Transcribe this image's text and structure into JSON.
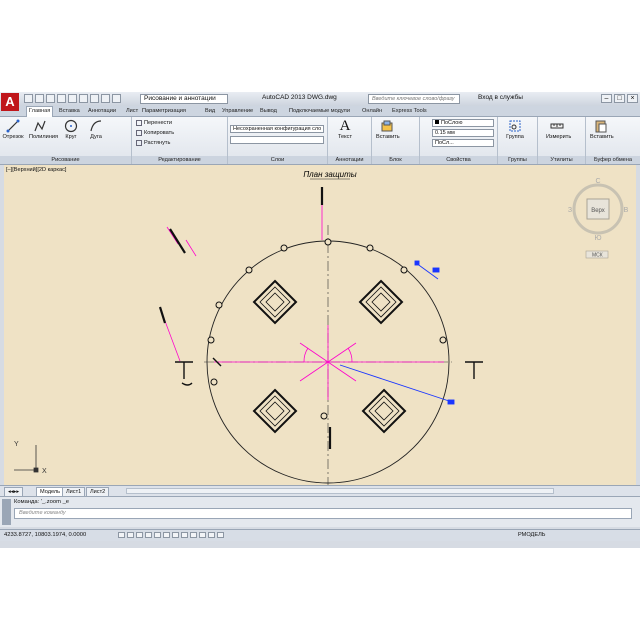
{
  "app": {
    "logo_letter": "A",
    "workspace": "Рисование и аннотации",
    "title": "AutoCAD 2013    DWG.dwg",
    "search_placeholder": "Введите ключевое слово/фразу",
    "login": "Вход в службы",
    "window_buttons": [
      "–",
      "□",
      "×"
    ]
  },
  "tabs": [
    "Главная",
    "Вставка",
    "Аннотации",
    "Лист",
    "Параметризация",
    "Вид",
    "Управление",
    "Вывод",
    "Подключаемые модули",
    "Онлайн",
    "Express Tools"
  ],
  "ribbon": {
    "draw": {
      "title": "Рисование",
      "buttons": [
        "Отрезок",
        "Полилиния",
        "Круг",
        "Дуга"
      ]
    },
    "modify": {
      "title": "Редактирование",
      "items": [
        "Перенести",
        "Копировать",
        "Растянуть"
      ]
    },
    "layers": {
      "title": "Слои",
      "combo": "Несохраненная конфигурация сло"
    },
    "annotation": {
      "title": "Аннотации",
      "button": "Текст"
    },
    "block": {
      "title": "Блок",
      "button": "Вставить"
    },
    "properties": {
      "title": "Свойства",
      "color": "ПоСлою",
      "lineweight": "0.15 мм",
      "linetype": "ПоСл..."
    },
    "groups": {
      "title": "Группы",
      "button": "Группа"
    },
    "utilities": {
      "title": "Утилиты",
      "button": "Измерить"
    },
    "clipboard": {
      "title": "Буфер обмена",
      "button": "Вставить"
    }
  },
  "viewport": {
    "label": "[–][Верхний][2D каркас]",
    "drawing_title": "План защиты",
    "viewcube_face": "Верх",
    "viewcube_n": "С",
    "viewcube_s": "Ю",
    "viewcube_w": "З",
    "viewcube_e": "В",
    "wcs": "МСК",
    "ucs_x": "X",
    "ucs_y": "Y"
  },
  "layout_tabs": [
    "Модель",
    "Лист1",
    "Лист2"
  ],
  "command": {
    "history": "Команда:  '_.zoom _e",
    "placeholder": "Введите команду"
  },
  "status": {
    "coordinates": "4233.8727, 10803.1974, 0.0000",
    "mode": "РМОДЕЛЬ"
  },
  "colors": {
    "paper": "#efe2c5",
    "accent_magenta": "#ff00cc",
    "accent_blue": "#1a36ff"
  }
}
